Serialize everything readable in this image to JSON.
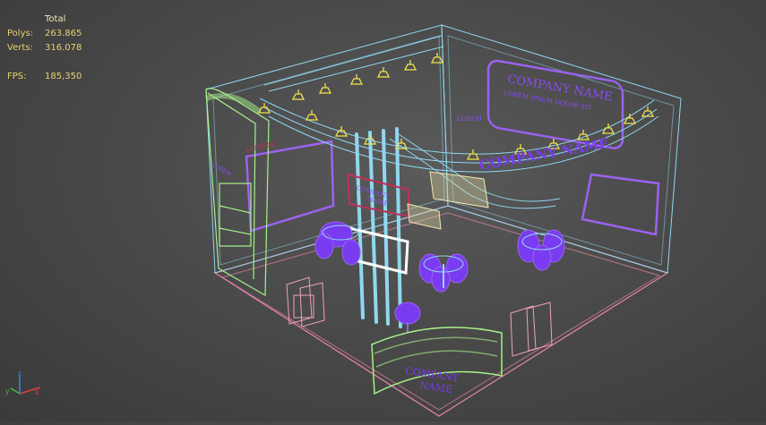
{
  "stats": {
    "header": "Total",
    "polys_label": "Polys:",
    "polys_value": "263.865",
    "verts_label": "Verts:",
    "verts_value": "316.078",
    "fps_label": "FPS:",
    "fps_value": "185,350"
  },
  "booth_texts": {
    "header_company": "COMPANY NAME",
    "header_lorem": "LOREM IPSUM DOLOR SIT",
    "left_lorem": "LOREM",
    "left_lorem2": "LOREM",
    "screen_company": "COMPANY",
    "screen_name": "NAME",
    "curve_lorem": "LOREM",
    "arc_company": "COMPANY NAME",
    "counter_company": "COMPANY",
    "counter_name": "NAME"
  },
  "axis_gizmo": {
    "x_label": "x",
    "y_label": "y",
    "z_label": "z"
  },
  "colors": {
    "background": "#4a4a4a",
    "stats_text": "#e6d070",
    "wire_cyan": "#8fd8f0",
    "wire_green": "#a8f08a",
    "wire_pink": "#e884a8",
    "wire_purple": "#9a62f0",
    "furniture_purple": "#7a3cf0",
    "lights_yellow": "#f2e24c"
  }
}
